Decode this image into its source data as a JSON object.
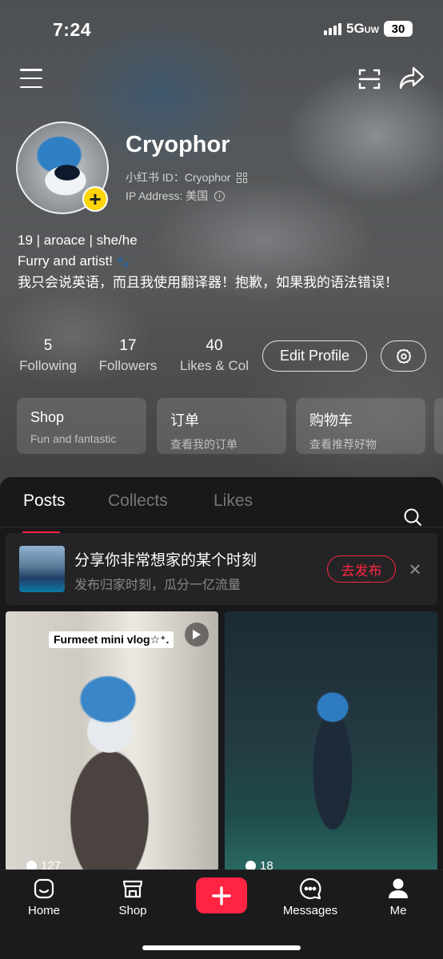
{
  "status_bar": {
    "time": "7:24",
    "network": "5G",
    "network_sub": "UW",
    "battery": "30"
  },
  "profile": {
    "name": "Cryophor",
    "id_text": "小红书 ID：Cryophor",
    "ip_text": "IP Address: 美国",
    "bio_line1": "19 | aroace | she/he",
    "bio_line2": "Furry and artist!",
    "bio_line3": "我只会说英语，而且我使用翻译器！抱歉，如果我的语法错误！"
  },
  "stats": [
    {
      "value": "5",
      "label": "Following"
    },
    {
      "value": "17",
      "label": "Followers"
    },
    {
      "value": "40",
      "label": "Likes & Col"
    }
  ],
  "actions": {
    "edit_profile": "Edit Profile"
  },
  "cards": [
    {
      "title": "Shop",
      "subtitle": "Fun and fantastic"
    },
    {
      "title": "订单",
      "subtitle": "查看我的订单"
    },
    {
      "title": "购物车",
      "subtitle": "查看推荐好物"
    }
  ],
  "tabs": [
    "Posts",
    "Collects",
    "Likes"
  ],
  "active_tab": "Posts",
  "promo": {
    "title": "分享你非常想家的某个时刻",
    "subtitle": "发布归家时刻，瓜分一亿流量",
    "button": "去发布",
    "close": "×"
  },
  "posts": [
    {
      "label": "Furmeet mini vlog☆⁺.",
      "count": "127",
      "type": "video"
    },
    {
      "label": "",
      "count": "18",
      "type": "image"
    }
  ],
  "bottom_nav": [
    {
      "label": "Home",
      "icon": "home-icon"
    },
    {
      "label": "Shop",
      "icon": "shop-icon"
    },
    {
      "label": "",
      "icon": "plus-icon"
    },
    {
      "label": "Messages",
      "icon": "messages-icon"
    },
    {
      "label": "Me",
      "icon": "person-icon"
    }
  ],
  "colors": {
    "accent": "#ff2442",
    "badge": "#ffd60a",
    "panel_bg": "#19191b"
  }
}
